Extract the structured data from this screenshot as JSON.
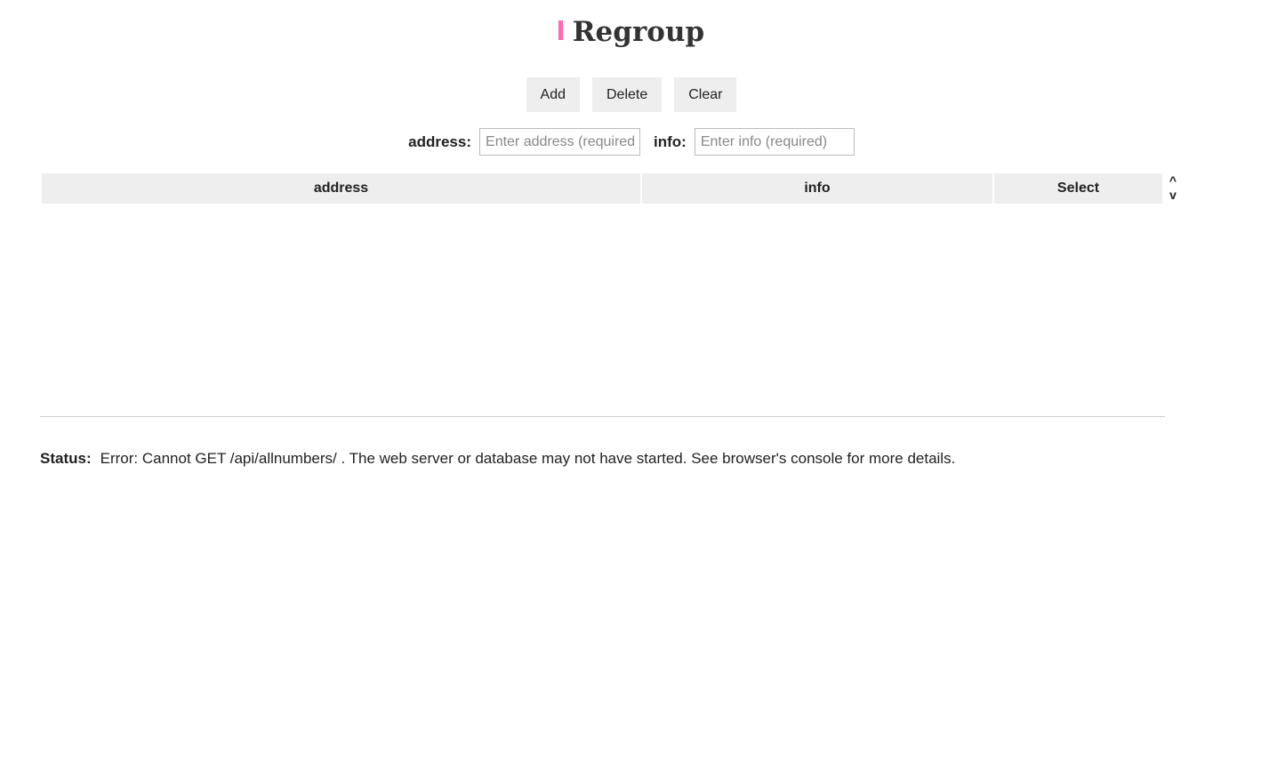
{
  "header": {
    "title": "Regroup",
    "accent_color": "#ff69b4"
  },
  "toolbar": {
    "add_label": "Add",
    "delete_label": "Delete",
    "clear_label": "Clear"
  },
  "form": {
    "address_label": "address:",
    "address_placeholder": "Enter address (required)",
    "address_value": "",
    "info_label": "info:",
    "info_placeholder": "Enter info (required)",
    "info_value": ""
  },
  "table": {
    "columns": [
      "address",
      "info",
      "Select"
    ],
    "rows": [],
    "sort_up_label": "^",
    "sort_down_label": "v"
  },
  "status": {
    "label": "Status:",
    "message": "Error: Cannot GET /api/allnumbers/ . The web server or database may not have started. See browser's console for more details."
  }
}
